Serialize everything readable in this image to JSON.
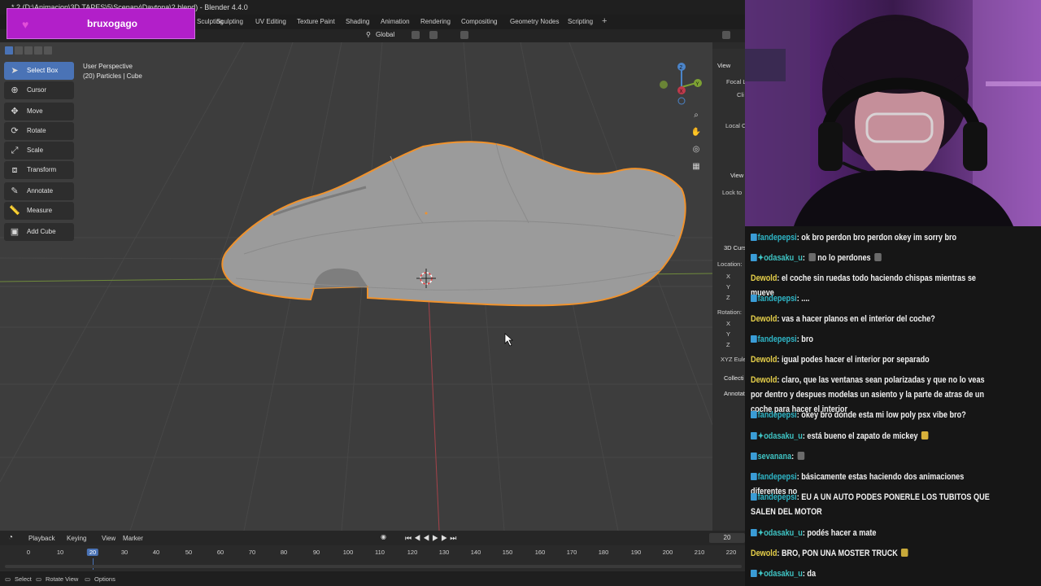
{
  "blender": {
    "title": "* 2 (D:\\Animacion\\3D TAPES\\5\\Scenary\\Daytona\\2.blend) - Blender 4.4.0",
    "workspace_tabs": [
      "Sculpting",
      "UV Editing",
      "Texture Paint",
      "Shading",
      "Animation",
      "Rendering",
      "Compositing",
      "Geometry Nodes",
      "Scripting"
    ],
    "orientation": "Global",
    "viewport": {
      "perspective": "User Perspective",
      "object": "(20) Particles | Cube"
    },
    "tools": [
      {
        "label": "Select Box",
        "icon": "select-box-icon",
        "active": true
      },
      {
        "label": "Cursor",
        "icon": "cursor-icon"
      },
      {
        "label": "Move",
        "icon": "move-icon"
      },
      {
        "label": "Rotate",
        "icon": "rotate-icon"
      },
      {
        "label": "Scale",
        "icon": "scale-icon"
      },
      {
        "label": "Transform",
        "icon": "transform-icon"
      },
      {
        "label": "Annotate",
        "icon": "annotate-icon"
      },
      {
        "label": "Measure",
        "icon": "measure-icon"
      },
      {
        "label": "Add Cube",
        "icon": "add-cube-icon"
      }
    ],
    "npanel": {
      "view": "View",
      "focal": "Focal L",
      "clip": "Cli",
      "local": "Local C",
      "view2": "View",
      "lock": "Lock to",
      "cursor": "3D Curs",
      "location": "Location:",
      "x": "X",
      "y": "Y",
      "z": "Z",
      "rotation": "Rotation:",
      "rx": "X",
      "ry": "Y",
      "rz": "Z",
      "euler": "XYZ Eule",
      "collection": "Collecti",
      "annotations": "Annotat"
    },
    "timeline": {
      "menus": [
        "Playback",
        "Keying",
        "View",
        "Marker"
      ],
      "current_frame": "20",
      "ticks": [
        "0",
        "10",
        "20",
        "30",
        "40",
        "50",
        "60",
        "70",
        "80",
        "90",
        "100",
        "110",
        "120",
        "130",
        "140",
        "150",
        "160",
        "170",
        "180",
        "190",
        "200",
        "210",
        "220"
      ]
    },
    "status": {
      "select": "Select",
      "rotate_view": "Rotate View",
      "options": "Options"
    }
  },
  "overlay": {
    "channel": "bruxogago",
    "accent": "#b21fc9"
  },
  "chat": [
    {
      "user": "fandepepsi",
      "color": "#2fb7c8",
      "badge": true,
      "text": "ok bro perdon bro perdon okey im sorry bro"
    },
    {
      "user": "odasaku_u",
      "color": "#3fc4c4",
      "badge": true,
      "text": "no lo perdones",
      "emote_before": true,
      "emote_after": true
    },
    {
      "user": "Dewold",
      "color": "#e8d14a",
      "badge": false,
      "text": "el coche sin ruedas todo haciendo chispas mientras se mueve"
    },
    {
      "user": "fandepepsi",
      "color": "#2fb7c8",
      "badge": true,
      "text": "...."
    },
    {
      "user": "Dewold",
      "color": "#e8d14a",
      "badge": false,
      "text": "vas a hacer planos en el interior del coche?"
    },
    {
      "user": "fandepepsi",
      "color": "#2fb7c8",
      "badge": true,
      "text": "bro"
    },
    {
      "user": "Dewold",
      "color": "#e8d14a",
      "badge": false,
      "text": "igual podes hacer el interior por separado"
    },
    {
      "user": "Dewold",
      "color": "#e8d14a",
      "badge": false,
      "text": "claro, que las ventanas sean polarizadas y que no lo veas por dentro y despues modelas un asiento y la parte de atras de un coche para hacer el interior"
    },
    {
      "user": "fandepepsi",
      "color": "#2fb7c8",
      "badge": true,
      "text": "okey bro donde esta mi low poly psx vibe bro?"
    },
    {
      "user": "odasaku_u",
      "color": "#3fc4c4",
      "badge": true,
      "text": "está bueno el zapato de mickey",
      "emote_after": true
    },
    {
      "user": "sevanana",
      "color": "#3fc4c4",
      "badge": true,
      "text": "",
      "emote_after": true
    },
    {
      "user": "fandepepsi",
      "color": "#2fb7c8",
      "badge": true,
      "text": "básicamente estas haciendo dos animaciones diferentes no"
    },
    {
      "user": "fandepepsi",
      "color": "#2fb7c8",
      "badge": true,
      "text": "EU A UN AUTO PODES PONERLE LOS TUBITOS QUE SALEN DEL MOTOR"
    },
    {
      "user": "odasaku_u",
      "color": "#3fc4c4",
      "badge": true,
      "text": "podés hacer a mate"
    },
    {
      "user": "Dewold",
      "color": "#e8d14a",
      "badge": false,
      "text": "BRO, PON UNA MOSTER TRUCK",
      "emote_after": true
    },
    {
      "user": "odasaku_u",
      "color": "#3fc4c4",
      "badge": true,
      "text": "da"
    }
  ]
}
